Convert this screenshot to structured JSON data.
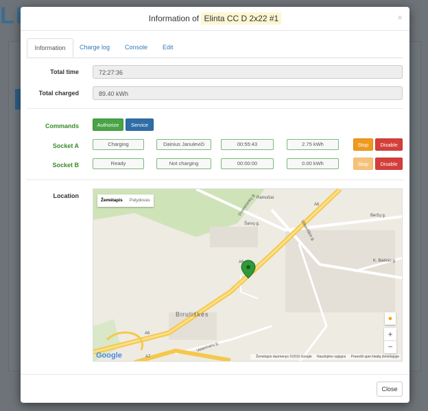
{
  "modal": {
    "title_prefix": "Information of",
    "title_name": "Elinta CC D 2x22 #1",
    "close_symbol": "×"
  },
  "tabs": [
    {
      "label": "Information",
      "active": true
    },
    {
      "label": "Charge log",
      "active": false
    },
    {
      "label": "Console",
      "active": false
    },
    {
      "label": "Edit",
      "active": false
    }
  ],
  "info": {
    "total_time_label": "Total time",
    "total_time_value": "72:27:36",
    "total_charged_label": "Total charged",
    "total_charged_value": "89.40 kWh"
  },
  "commands": {
    "label": "Commands",
    "authorize": "Authorize",
    "service": "Service"
  },
  "sockets": [
    {
      "label": "Socket A",
      "status": "Charging",
      "user": "Dainius Januleviči",
      "time": "00:55:43",
      "energy": "2.75 kWh",
      "stop": "Stop",
      "disable": "Disable",
      "stop_enabled": true
    },
    {
      "label": "Socket B",
      "status": "Ready",
      "user": "Not charging",
      "time": "00:00:00",
      "energy": "0.00 kWh",
      "stop": "Stop",
      "disable": "Disable",
      "stop_enabled": false
    }
  ],
  "location": {
    "label": "Location",
    "map_tab_map": "Žemėlapis",
    "map_tab_satellite": "Palydovas",
    "town": "Biruliškės",
    "place_ramuciai": "Ramučiai",
    "street_1": "Dvarelninkų g.",
    "street_2": "Šarvų g.",
    "street_3": "Vilkaviškio g.",
    "street_4": "Beržų g.",
    "street_5": "K. Bielinio g.",
    "street_6": "Veterinarų g.",
    "road_a": "A6",
    "road_b": "A6",
    "road_c": "A6",
    "road_d": "A7",
    "google": "Google",
    "attrib_data": "Žemėlapio duomenys ©2016 Google",
    "attrib_terms": "Naudojimo sąlygos",
    "attrib_report": "Pranešti apie klaidą žemėlapyje",
    "zoom_in": "+",
    "zoom_out": "−"
  },
  "footer": {
    "close_label": "Close"
  },
  "colors": {
    "green_button": "#48a444",
    "blue_button": "#2f6da8",
    "orange_button": "#ef9a1f",
    "red_button": "#d43f3a",
    "label_green": "#3a8a2a",
    "link_blue": "#337ab7"
  }
}
